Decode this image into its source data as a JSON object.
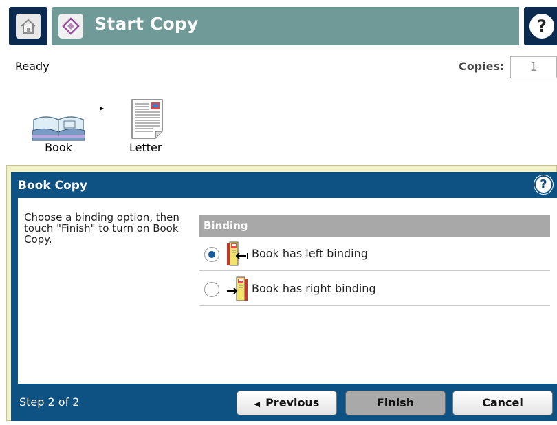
{
  "header": {
    "title": "Start Copy",
    "home_icon": "home-icon",
    "start_icon": "start-diamond-icon",
    "help_glyph": "?"
  },
  "status": {
    "text": "Ready",
    "copies_label": "Copies:",
    "copies_value": "1"
  },
  "workflow": {
    "source_label": "Book",
    "target_label": "Letter",
    "arrow": "▸"
  },
  "dialog": {
    "title": "Book Copy",
    "help_glyph": "?",
    "instructions": "Choose a binding option, then touch \"Finish\" to turn on Book Copy.",
    "binding_header": "Binding",
    "options": [
      {
        "label": "Book has left binding",
        "selected": true
      },
      {
        "label": "Book has right binding",
        "selected": false
      }
    ],
    "step": "Step 2 of 2",
    "buttons": {
      "previous": "Previous",
      "finish": "Finish",
      "cancel": "Cancel"
    }
  },
  "colors": {
    "title_bar": "#6f9a97",
    "nav_dark": "#0b2a4f",
    "dialog_blue": "#0e5183",
    "binding_header": "#a8a8a8"
  }
}
